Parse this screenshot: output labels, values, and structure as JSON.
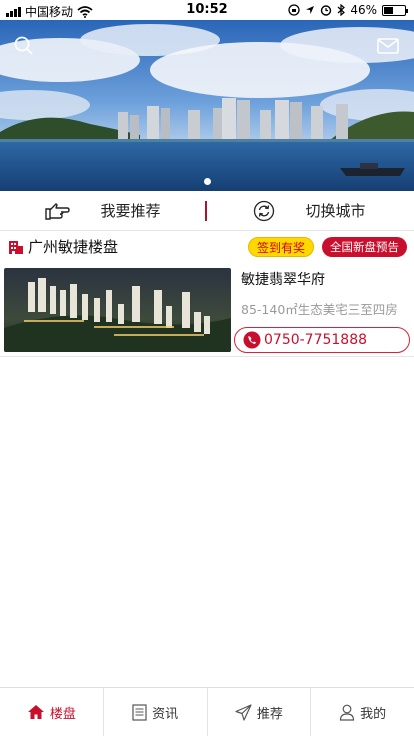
{
  "status_bar": {
    "carrier": "中国移动",
    "time": "10:52",
    "battery": "46%",
    "battery_level": 0.46
  },
  "banner": {
    "slide_count": 1,
    "active_slide": 1
  },
  "actions": {
    "recommend_label": "我要推荐",
    "switch_city_label": "切换城市"
  },
  "section": {
    "title": "广州敏捷楼盘",
    "badge_checkin": "签到有奖",
    "badge_preview": "全国新盘预告"
  },
  "listings": [
    {
      "name": "敏捷翡翠华府",
      "description": "85-140㎡生态美宅三至四房",
      "phone": "0750-7751888"
    }
  ],
  "tabs": [
    {
      "label": "楼盘",
      "icon": "home-icon",
      "active": true
    },
    {
      "label": "资讯",
      "icon": "news-icon",
      "active": false
    },
    {
      "label": "推荐",
      "icon": "send-icon",
      "active": false
    },
    {
      "label": "我的",
      "icon": "user-icon",
      "active": false
    }
  ],
  "colors": {
    "brand_red": "#c8102e",
    "badge_yellow": "#ffd800"
  }
}
